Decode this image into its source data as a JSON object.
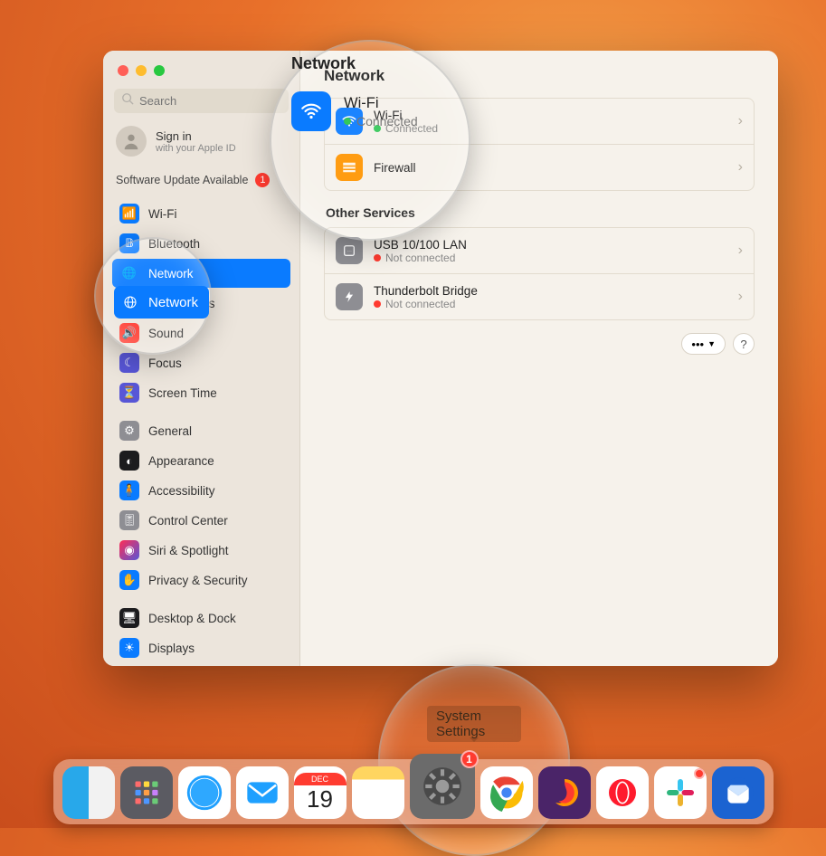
{
  "window": {
    "search_placeholder": "Search",
    "signin_title": "Sign in",
    "signin_sub": "with your Apple ID",
    "update_label": "Software Update Available",
    "update_count": "1"
  },
  "sidebar": {
    "items": [
      {
        "label": "Wi-Fi",
        "icon": "wifi",
        "cls": "ic-wifi"
      },
      {
        "label": "Bluetooth",
        "icon": "bt",
        "cls": "ic-bt"
      },
      {
        "label": "Network",
        "icon": "globe",
        "cls": "ic-net",
        "active": true
      },
      {
        "label": "Notifications",
        "icon": "bell",
        "cls": "ic-notif"
      },
      {
        "label": "Sound",
        "icon": "speaker",
        "cls": "ic-sound"
      },
      {
        "label": "Focus",
        "icon": "moon",
        "cls": "ic-focus"
      },
      {
        "label": "Screen Time",
        "icon": "hourglass",
        "cls": "ic-screen"
      }
    ],
    "group2": [
      {
        "label": "General",
        "icon": "gear",
        "cls": "ic-general"
      },
      {
        "label": "Appearance",
        "icon": "appear",
        "cls": "ic-appear"
      },
      {
        "label": "Accessibility",
        "icon": "access",
        "cls": "ic-access"
      },
      {
        "label": "Control Center",
        "icon": "cc",
        "cls": "ic-cc"
      },
      {
        "label": "Siri & Spotlight",
        "icon": "siri",
        "cls": "ic-siri"
      },
      {
        "label": "Privacy & Security",
        "icon": "hand",
        "cls": "ic-priv"
      }
    ],
    "group3": [
      {
        "label": "Desktop & Dock",
        "icon": "dock",
        "cls": "ic-desk"
      },
      {
        "label": "Displays",
        "icon": "display",
        "cls": "ic-disp"
      }
    ]
  },
  "main": {
    "title": "Network",
    "primary": [
      {
        "name": "Wi-Fi",
        "status": "Connected",
        "ok": true,
        "icon": "ci-wifi"
      },
      {
        "name": "Firewall",
        "status": "",
        "ok": null,
        "icon": "ci-fw"
      }
    ],
    "other_label": "Other Services",
    "other": [
      {
        "name": "USB 10/100 LAN",
        "status": "Not connected",
        "ok": false,
        "icon": "ci-lan"
      },
      {
        "name": "Thunderbolt Bridge",
        "status": "Not connected",
        "ok": false,
        "icon": "ci-tb"
      }
    ],
    "more_glyph": "•••",
    "help_glyph": "?"
  },
  "lens": {
    "top_title": "Network",
    "top_service": "Wi-Fi",
    "top_status": "Connected",
    "left_label": "Network",
    "bottom_tooltip": "System Settings"
  },
  "dock": {
    "settings_badge": "1",
    "cal_month": "DEC",
    "cal_day": "19"
  }
}
